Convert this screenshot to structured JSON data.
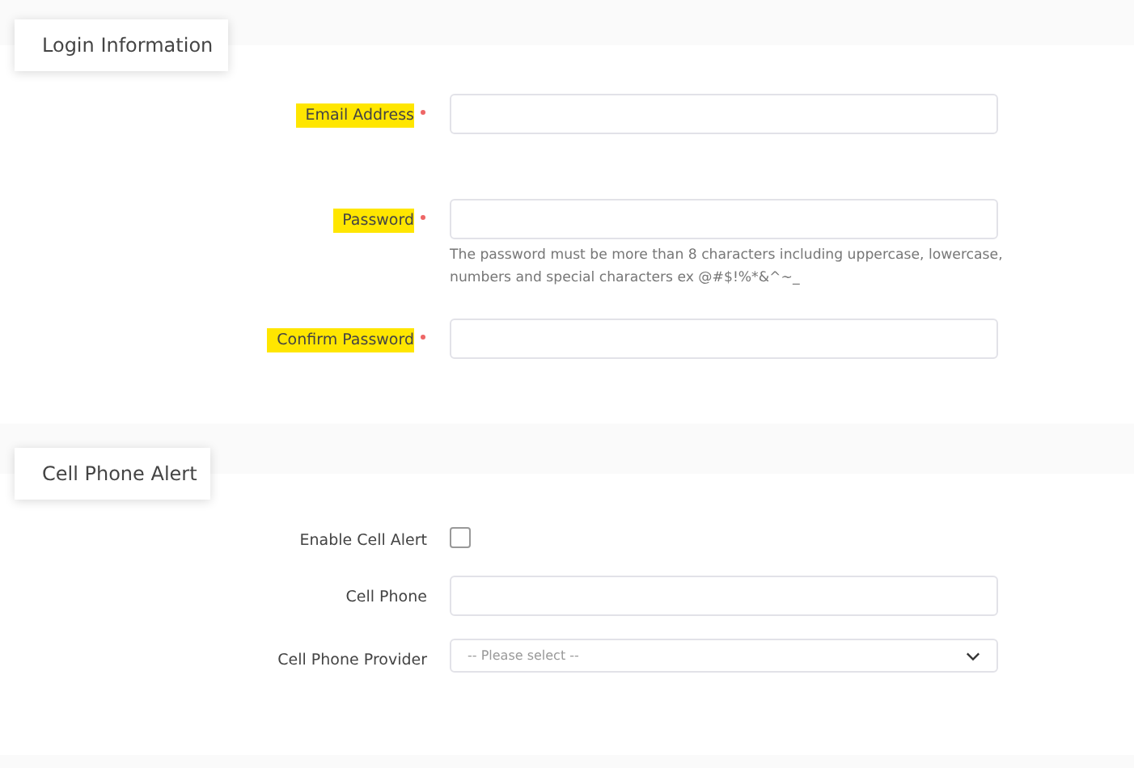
{
  "sections": [
    {
      "title": "Login Information",
      "fields": [
        {
          "kind": "text",
          "label": "Email Address",
          "required": true,
          "highlighted": true
        },
        {
          "kind": "text",
          "label": "Password",
          "required": true,
          "highlighted": true,
          "hint": "The password must be more than 8 characters including uppercase, lowercase, numbers and special characters ex @#$!%*&^~_"
        },
        {
          "kind": "text",
          "label": "Confirm Password",
          "required": true,
          "highlighted": true
        }
      ]
    },
    {
      "title": "Cell Phone Alert",
      "fields": [
        {
          "kind": "checkbox",
          "label": "Enable Cell Alert",
          "required": false,
          "highlighted": false,
          "checked": false
        },
        {
          "kind": "text",
          "label": "Cell Phone",
          "required": false,
          "highlighted": false
        },
        {
          "kind": "select",
          "label": "Cell Phone Provider",
          "required": false,
          "highlighted": false,
          "placeholder": "-- Please select --"
        }
      ]
    }
  ]
}
